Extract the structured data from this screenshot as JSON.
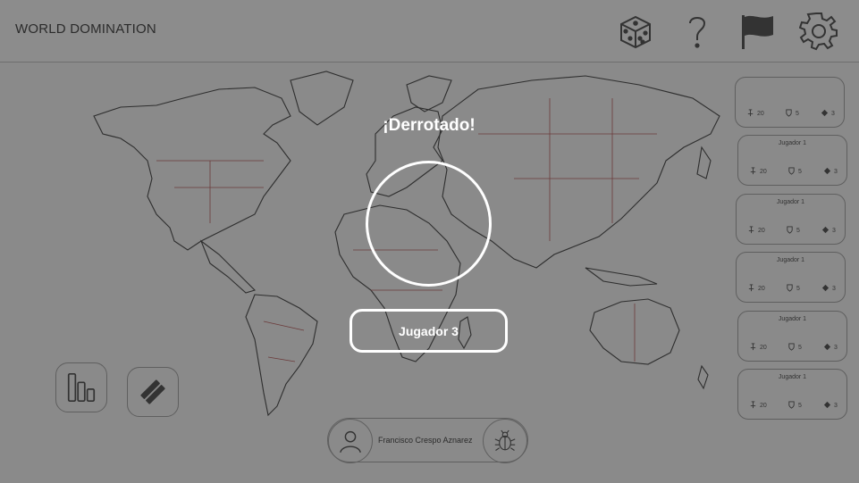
{
  "app": {
    "title": "WORLD DOMINATION"
  },
  "toolbar": {
    "icons": [
      "dice-icon",
      "help-icon",
      "flag-icon",
      "gear-icon"
    ]
  },
  "overlay": {
    "title": "¡Derrotado!",
    "player_label": "Jugador 3"
  },
  "players": [
    {
      "name": "",
      "troops": "20",
      "defense": "5",
      "cards": "3"
    },
    {
      "name": "Jugador 1",
      "troops": "20",
      "defense": "5",
      "cards": "3"
    },
    {
      "name": "Jugador 1",
      "troops": "20",
      "defense": "5",
      "cards": "3"
    },
    {
      "name": "Jugador 1",
      "troops": "20",
      "defense": "5",
      "cards": "3"
    },
    {
      "name": "Jugador 1",
      "troops": "20",
      "defense": "5",
      "cards": "3"
    },
    {
      "name": "Jugador 1",
      "troops": "20",
      "defense": "5",
      "cards": "3"
    }
  ],
  "user": {
    "name": "Francisco Crespo Aznarez"
  },
  "colors": {
    "overlay_accent": "#ffffff",
    "background": "#8a8a8a"
  }
}
